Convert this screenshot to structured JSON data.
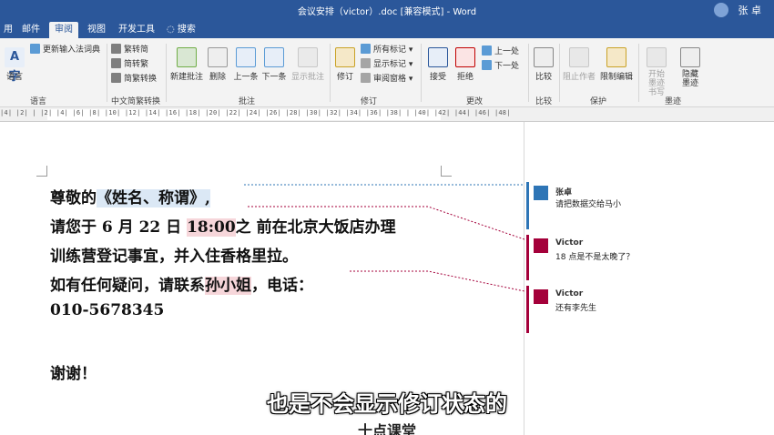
{
  "window": {
    "title": "会议安排（victor）.doc [兼容模式] - Word",
    "user": "张 卓"
  },
  "tabs": [
    {
      "label": "用",
      "active": false
    },
    {
      "label": "邮件",
      "active": false
    },
    {
      "label": "审阅",
      "active": true
    },
    {
      "label": "视图",
      "active": false
    },
    {
      "label": "开发工具",
      "active": false
    }
  ],
  "tell_me": "搜索",
  "ribbon": {
    "language": {
      "translate": "语言",
      "update_ime": "更新输入法词典",
      "label": "语言"
    },
    "chinese": {
      "to_trad": "繁转简",
      "to_simp": "简转繁",
      "convert": "简繁转换",
      "label": "中文简繁转换"
    },
    "comments": {
      "new": "新建批注",
      "delete": "删除",
      "prev": "上一条",
      "next": "下一条",
      "show": "显示批注",
      "label": "批注"
    },
    "tracking": {
      "track": "修订",
      "all_markup": "所有标记",
      "show_markup": "显示标记",
      "review_pane": "审阅窗格",
      "label": "修订"
    },
    "changes": {
      "accept": "接受",
      "reject": "拒绝",
      "previous": "上一处",
      "next": "下一处",
      "label": "更改"
    },
    "compare": {
      "compare": "比较",
      "label": "比较"
    },
    "protect": {
      "block_authors": "阻止作者",
      "restrict": "限制编辑",
      "label": "保护"
    },
    "ink": {
      "start_ink": "开始墨迹书写",
      "hide_ink": "隐藏墨迹",
      "label": "墨迹"
    }
  },
  "ruler": "|4|  |2|  |  |2|  |4|  |6|  |8|  |10|  |12|  |14|  |16|  |18|  |20|  |22|  |24|  |26|  |28|  |30|  |32|  |34|  |36|  |38|  |  |40|  |42|  |44|  |46|  |48|",
  "document": {
    "l1_pre": "尊敬的",
    "l1_hl": "《姓名、称谓》,",
    "l2_pre": "请您于 6 月 22 日 ",
    "l2_hl": "18:00",
    "l2_post": "之 前在北京大饭店办理",
    "l3": "训练营登记事宜，并入住香格里拉。",
    "l4_pre": "如有任何疑问，请联系",
    "l4_hl": "孙小姐",
    "l4_post": "，电话：",
    "l5": "010-5678345",
    "l7": "谢谢！"
  },
  "comments": [
    {
      "author": "张卓",
      "text": "请把数据交给马小",
      "color": "#2e75b6"
    },
    {
      "author": "Victor",
      "text": "18 点是不是太晚了？",
      "color": "#a4003a"
    },
    {
      "author": "Victor",
      "text": "还有李先生",
      "color": "#a4003a"
    }
  ],
  "subtitles": {
    "main": "也是不会显示修订状态的",
    "watermark": "十点课堂"
  }
}
